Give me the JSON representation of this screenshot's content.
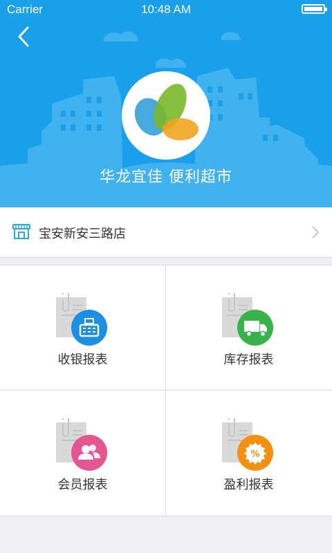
{
  "status_bar": {
    "carrier": "Carrier",
    "time": "10:48 AM"
  },
  "header": {
    "store_name": "华龙宜佳  便利超市",
    "background_color": "#1aa0ea",
    "back_icon": "chevron-left-icon",
    "logo_icon": "three-leaf-logo-icon"
  },
  "branch": {
    "label": "宝安新安三路店",
    "icon": "storefront-icon",
    "chevron_icon": "chevron-right-icon"
  },
  "reports": [
    {
      "label": "收银报表",
      "icon": "cash-register-icon",
      "color": "#1a8fe3"
    },
    {
      "label": "库存报表",
      "icon": "truck-icon",
      "color": "#37b34a"
    },
    {
      "label": "会员报表",
      "icon": "members-icon",
      "color": "#e4568f"
    },
    {
      "label": "盈利报表",
      "icon": "percent-icon",
      "color": "#f3900f"
    }
  ]
}
